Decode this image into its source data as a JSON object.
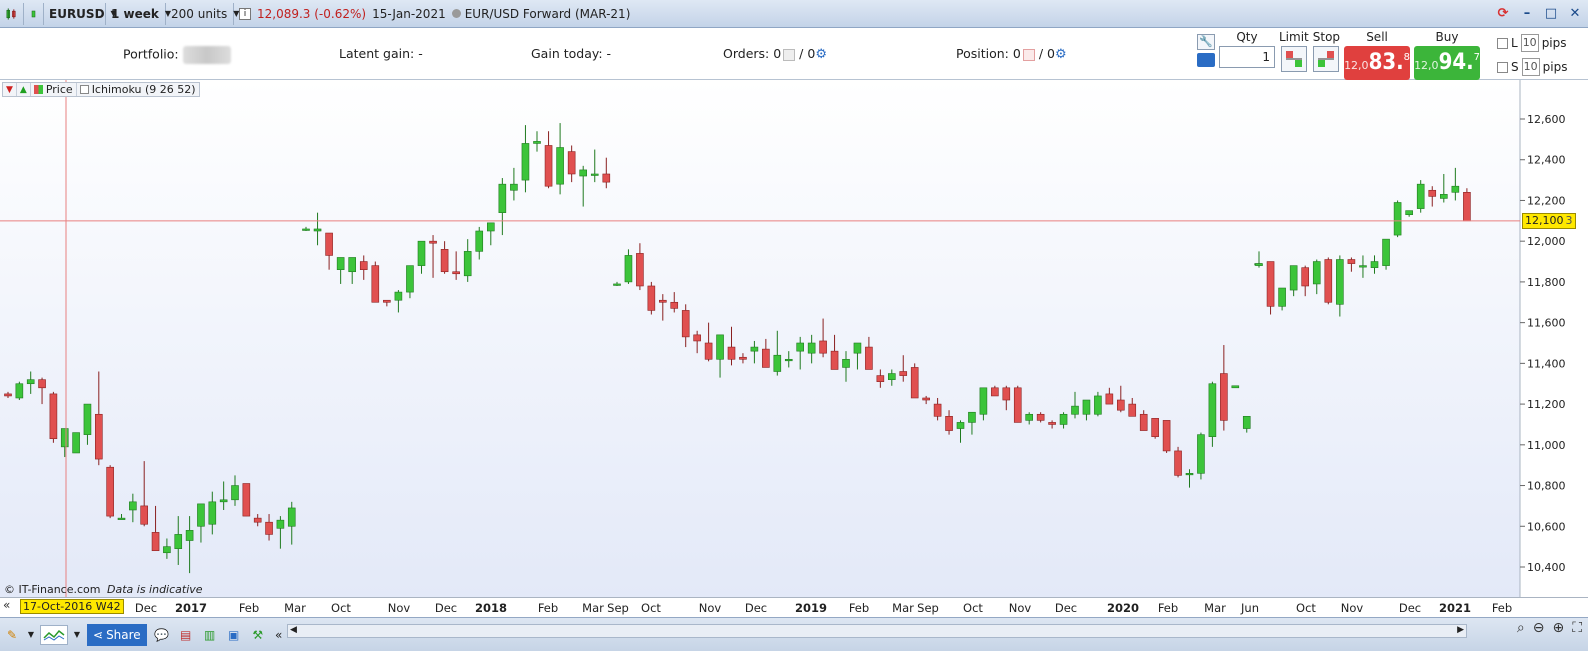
{
  "titlebar": {
    "symbol": "EURUSD",
    "period": "1 week",
    "units": "200 units",
    "price_change": "12,089.3 (-0.62%)",
    "date": "15-Jan-2021",
    "instrument": "EUR/USD Forward (MAR-21)"
  },
  "infobar": {
    "portfolio_label": "Portfolio:",
    "latent_label": "Latent gain:",
    "latent_value": "-",
    "gain_today_label": "Gain today:",
    "gain_today_value": "-",
    "orders_label": "Orders:",
    "orders_a": "0",
    "orders_b": "/ 0",
    "position_label": "Position:",
    "position_a": "0",
    "position_b": "/ 0"
  },
  "trade": {
    "qty_label": "Qty",
    "qty_value": "1",
    "limit_label": "Limit",
    "stop_label": "Stop",
    "sell_label": "Sell",
    "buy_label": "Buy",
    "sell_prefix": "12,0",
    "sell_big": "83.",
    "sell_sup": "8",
    "buy_prefix": "12,0",
    "buy_big": "94.",
    "buy_sup": "7",
    "pip_l": "L",
    "pip_s": "S",
    "pip_l_value": "10",
    "pip_s_value": "10",
    "pips_label": "pips",
    "colors": {
      "sell": "#e0403e",
      "buy": "#3cb53a"
    }
  },
  "legend": {
    "price_label": "Price",
    "ichimoku_label": "Ichimoku (9 26 52)"
  },
  "footer": {
    "copyright": "© IT-Finance.com",
    "note": "Data is indicative"
  },
  "cursor": {
    "date_label": "17-Oct-2016 W42",
    "price_label": "12,100",
    "price_suffix": "3"
  },
  "toolbar": {
    "share_label": "Share"
  },
  "chart_data": {
    "type": "candlestick",
    "y_ticks": [
      "12,600",
      "12,400",
      "12,200",
      "12,000",
      "11,800",
      "11,600",
      "11,400",
      "11,200",
      "11,000",
      "10,800",
      "10,600",
      "10,400"
    ],
    "y_tick_values": [
      12600,
      12400,
      12200,
      12000,
      11800,
      11600,
      11400,
      11200,
      11000,
      10800,
      10600,
      10400
    ],
    "ylim": [
      10260,
      12760
    ],
    "x_tick_labels": [
      "Dec",
      "2017",
      "Feb",
      "Mar",
      "Oct",
      "Nov",
      "Dec",
      "2018",
      "Feb",
      "Mar",
      "Sep",
      "Oct",
      "Nov",
      "Dec",
      "2019",
      "Feb",
      "Mar",
      "Sep",
      "Oct",
      "Nov",
      "Dec",
      "2020",
      "Feb",
      "Mar",
      "Jun",
      "Oct",
      "Nov",
      "Dec",
      "2021",
      "Feb"
    ],
    "x_tick_bold": [
      "2017",
      "2018",
      "2019",
      "2020",
      "2021"
    ],
    "colors": {
      "up": "#3cc43a",
      "down": "#e05050",
      "crosshair": "#e88080",
      "background_top": "#ffffff",
      "background_bottom": "#e3e9f8"
    },
    "crosshair_price": 12100,
    "candles": [
      [
        11250,
        11260,
        11230,
        11240
      ],
      [
        11230,
        11310,
        11220,
        11300
      ],
      [
        11300,
        11360,
        11250,
        11320
      ],
      [
        11320,
        11330,
        11200,
        11280
      ],
      [
        11250,
        11260,
        11010,
        11030
      ],
      [
        10990,
        11080,
        10940,
        11080
      ],
      [
        10960,
        11060,
        10960,
        11060
      ],
      [
        11050,
        11200,
        11000,
        11200
      ],
      [
        11150,
        11360,
        10900,
        10930
      ],
      [
        10890,
        10900,
        10640,
        10650
      ],
      [
        10640,
        10660,
        10640,
        10640
      ],
      [
        10680,
        10760,
        10620,
        10720
      ],
      [
        10700,
        10920,
        10600,
        10610
      ],
      [
        10570,
        10700,
        10490,
        10480
      ],
      [
        10470,
        10540,
        10440,
        10500
      ],
      [
        10490,
        10650,
        10410,
        10560
      ],
      [
        10530,
        10650,
        10370,
        10580
      ],
      [
        10600,
        10690,
        10520,
        10710
      ],
      [
        10610,
        10770,
        10560,
        10720
      ],
      [
        10720,
        10820,
        10680,
        10730
      ],
      [
        10730,
        10850,
        10700,
        10800
      ],
      [
        10810,
        10810,
        10650,
        10650
      ],
      [
        10640,
        10660,
        10600,
        10620
      ],
      [
        10620,
        10660,
        10530,
        10560
      ],
      [
        10590,
        10650,
        10490,
        10630
      ],
      [
        10600,
        10720,
        10510,
        10690
      ],
      [
        12060,
        12070,
        12050,
        12060
      ],
      [
        12050,
        12140,
        11980,
        12060
      ],
      [
        12040,
        12040,
        11860,
        11930
      ],
      [
        11860,
        11910,
        11790,
        11920
      ],
      [
        11850,
        11920,
        11790,
        11920
      ],
      [
        11900,
        11930,
        11810,
        11860
      ],
      [
        11880,
        11900,
        11700,
        11700
      ],
      [
        11710,
        11710,
        11680,
        11700
      ],
      [
        11710,
        11760,
        11650,
        11750
      ],
      [
        11750,
        11880,
        11720,
        11880
      ],
      [
        11880,
        11980,
        11840,
        12000
      ],
      [
        12000,
        12030,
        11820,
        11990
      ],
      [
        11960,
        12000,
        11840,
        11850
      ],
      [
        11850,
        11950,
        11810,
        11840
      ],
      [
        11830,
        12010,
        11800,
        11950
      ],
      [
        11950,
        12070,
        11910,
        12050
      ],
      [
        12050,
        12090,
        11980,
        12090
      ],
      [
        12140,
        12310,
        12030,
        12280
      ],
      [
        12250,
        12360,
        12200,
        12280
      ],
      [
        12300,
        12570,
        12240,
        12480
      ],
      [
        12480,
        12540,
        12440,
        12490
      ],
      [
        12470,
        12540,
        12260,
        12270
      ],
      [
        12280,
        12580,
        12230,
        12460
      ],
      [
        12440,
        12470,
        12290,
        12330
      ],
      [
        12320,
        12370,
        12170,
        12350
      ],
      [
        12330,
        12450,
        12290,
        12330
      ],
      [
        12330,
        12410,
        12260,
        12290
      ],
      [
        11790,
        11800,
        11780,
        11790
      ],
      [
        11800,
        11960,
        11790,
        11930
      ],
      [
        11940,
        11990,
        11760,
        11780
      ],
      [
        11780,
        11800,
        11640,
        11660
      ],
      [
        11710,
        11740,
        11610,
        11700
      ],
      [
        11700,
        11750,
        11650,
        11670
      ],
      [
        11660,
        11690,
        11480,
        11530
      ],
      [
        11540,
        11560,
        11450,
        11510
      ],
      [
        11500,
        11600,
        11410,
        11420
      ],
      [
        11420,
        11520,
        11330,
        11540
      ],
      [
        11480,
        11580,
        11390,
        11420
      ],
      [
        11430,
        11450,
        11400,
        11420
      ],
      [
        11460,
        11510,
        11400,
        11480
      ],
      [
        11470,
        11520,
        11410,
        11380
      ],
      [
        11360,
        11560,
        11340,
        11440
      ],
      [
        11420,
        11460,
        11380,
        11420
      ],
      [
        11460,
        11530,
        11370,
        11500
      ],
      [
        11450,
        11540,
        11400,
        11500
      ],
      [
        11510,
        11620,
        11430,
        11450
      ],
      [
        11460,
        11540,
        11380,
        11370
      ],
      [
        11380,
        11460,
        11310,
        11420
      ],
      [
        11450,
        11500,
        11370,
        11500
      ],
      [
        11480,
        11530,
        11380,
        11370
      ],
      [
        11340,
        11370,
        11280,
        11310
      ],
      [
        11320,
        11370,
        11290,
        11350
      ],
      [
        11360,
        11440,
        11310,
        11340
      ],
      [
        11380,
        11400,
        11280,
        11230
      ],
      [
        11230,
        11240,
        11200,
        11220
      ],
      [
        11200,
        11230,
        11120,
        11140
      ],
      [
        11140,
        11170,
        11050,
        11070
      ],
      [
        11080,
        11120,
        11010,
        11110
      ],
      [
        11110,
        11160,
        11050,
        11160
      ],
      [
        11150,
        11250,
        11120,
        11280
      ],
      [
        11280,
        11290,
        11260,
        11240
      ],
      [
        11280,
        11290,
        11170,
        11220
      ],
      [
        11280,
        11290,
        11110,
        11110
      ],
      [
        11120,
        11160,
        11100,
        11150
      ],
      [
        11150,
        11160,
        11110,
        11120
      ],
      [
        11110,
        11120,
        11080,
        11100
      ],
      [
        11100,
        11160,
        11080,
        11150
      ],
      [
        11150,
        11260,
        11130,
        11190
      ],
      [
        11150,
        11200,
        11120,
        11220
      ],
      [
        11150,
        11260,
        11140,
        11240
      ],
      [
        11250,
        11280,
        11220,
        11200
      ],
      [
        11220,
        11290,
        11160,
        11170
      ],
      [
        11200,
        11230,
        11160,
        11140
      ],
      [
        11150,
        11170,
        11090,
        11070
      ],
      [
        11130,
        11130,
        11030,
        11040
      ],
      [
        11120,
        11120,
        10960,
        10970
      ],
      [
        10970,
        10990,
        10840,
        10850
      ],
      [
        10860,
        10880,
        10790,
        10860
      ],
      [
        10860,
        11060,
        10830,
        11050
      ],
      [
        11040,
        11310,
        10990,
        11300
      ],
      [
        11350,
        11490,
        11070,
        11120
      ],
      [
        11280,
        11290,
        11280,
        11290
      ],
      [
        11080,
        11140,
        11060,
        11140
      ],
      [
        11890,
        11890,
        11880,
        11890
      ],
      [
        11880,
        11950,
        11870,
        11890
      ],
      [
        11900,
        11900,
        11640,
        11680
      ],
      [
        11680,
        11730,
        11660,
        11770
      ],
      [
        11760,
        11880,
        11730,
        11880
      ],
      [
        11870,
        11880,
        11730,
        11780
      ],
      [
        11790,
        11910,
        11740,
        11900
      ],
      [
        11910,
        11920,
        11690,
        11700
      ],
      [
        11690,
        11930,
        11630,
        11910
      ],
      [
        11910,
        11920,
        11850,
        11890
      ],
      [
        11880,
        11930,
        11820,
        11880
      ],
      [
        11870,
        11930,
        11840,
        11900
      ],
      [
        11880,
        12000,
        11860,
        12010
      ],
      [
        12030,
        12200,
        12020,
        12190
      ],
      [
        12130,
        12150,
        12120,
        12150
      ],
      [
        12160,
        12300,
        12140,
        12280
      ],
      [
        12250,
        12270,
        12170,
        12220
      ],
      [
        12210,
        12330,
        12190,
        12230
      ],
      [
        12240,
        12360,
        12200,
        12270
      ],
      [
        12240,
        12260,
        12100,
        12100
      ]
    ]
  }
}
